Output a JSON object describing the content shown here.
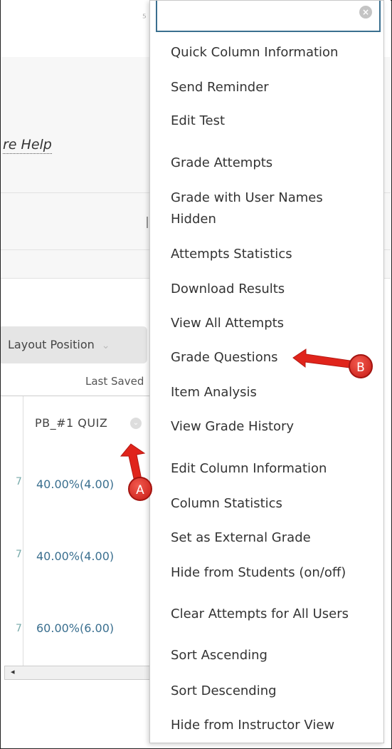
{
  "background": {
    "help_link": "re Help",
    "layout_button": "Layout Position",
    "last_saved": "Last Saved",
    "column_header": "PB_#1 QUIZ",
    "rows": [
      "40.00%(4.00)",
      "40.00%(4.00)",
      "60.00%(6.00)"
    ],
    "stub_char": "7"
  },
  "menu": {
    "search_value": "",
    "items": [
      "Quick Column Information",
      "Send Reminder",
      "Edit Test",
      "Grade Attempts",
      "Grade with User Names Hidden",
      "Attempts Statistics",
      "Download Results",
      "View All Attempts",
      "Grade Questions",
      "Item Analysis",
      "View Grade History",
      "Edit Column Information",
      "Column Statistics",
      "Set as External Grade",
      "Hide from Students (on/off)",
      "Clear Attempts for All Users",
      "Sort Ascending",
      "Sort Descending",
      "Hide from Instructor View"
    ]
  },
  "annotations": {
    "a_label": "A",
    "b_label": "B",
    "color": "#e0241b"
  }
}
